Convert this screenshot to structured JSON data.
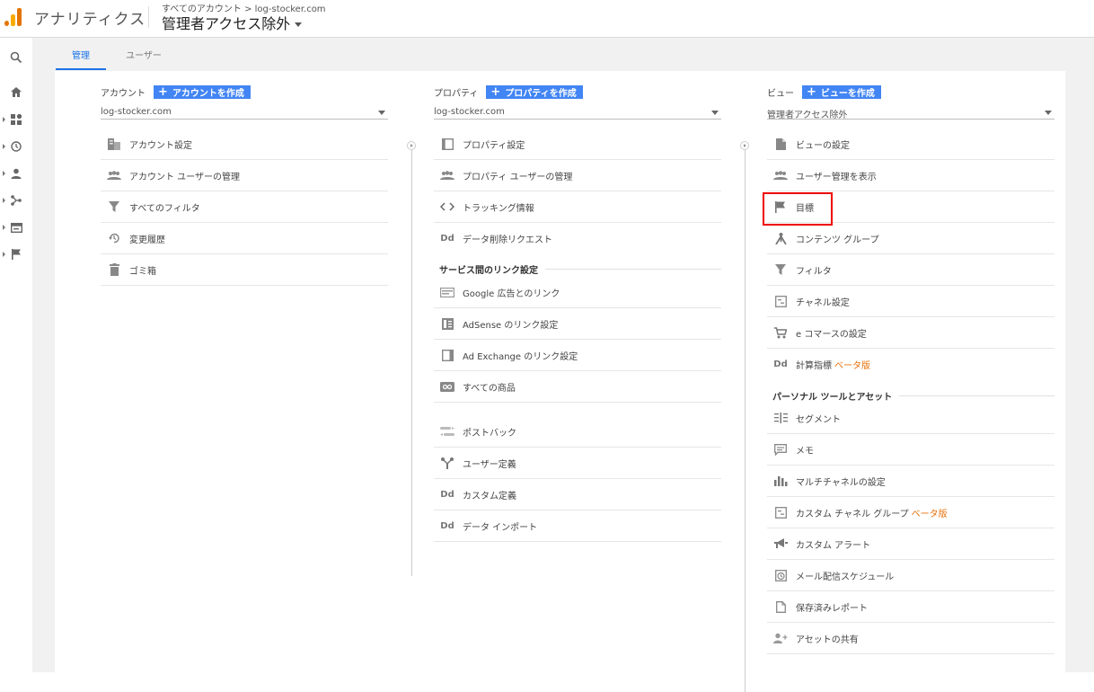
{
  "header": {
    "app_title": "アナリティクス",
    "breadcrumb": "すべてのアカウント > log-stocker.com",
    "view_name": "管理者アクセス除外"
  },
  "tabs": [
    {
      "label": "管理",
      "active": true
    },
    {
      "label": "ユーザー",
      "active": false
    }
  ],
  "account": {
    "heading": "アカウント",
    "create_label": "アカウントを作成",
    "selected": "log-stocker.com",
    "items": [
      {
        "label": "アカウント設定",
        "icon": "building-icon"
      },
      {
        "label": "アカウント ユーザーの管理",
        "icon": "users-icon"
      },
      {
        "label": "すべてのフィルタ",
        "icon": "filter-icon"
      },
      {
        "label": "変更履歴",
        "icon": "history-icon"
      },
      {
        "label": "ゴミ箱",
        "icon": "trash-icon"
      }
    ]
  },
  "property": {
    "heading": "プロパティ",
    "create_label": "プロパティを作成",
    "selected": "log-stocker.com",
    "items": [
      {
        "label": "プロパティ設定",
        "icon": "property-icon"
      },
      {
        "label": "プロパティ ユーザーの管理",
        "icon": "users-icon"
      },
      {
        "label": "トラッキング情報",
        "icon": "code-icon"
      },
      {
        "label": "データ削除リクエスト",
        "icon": "dd-icon"
      }
    ],
    "section_title": "サービス間のリンク設定",
    "link_items": [
      {
        "label": "Google 広告とのリンク",
        "icon": "google-ads-icon"
      },
      {
        "label": "AdSense のリンク設定",
        "icon": "adsense-icon"
      },
      {
        "label": "Ad Exchange のリンク設定",
        "icon": "ad-exchange-icon"
      },
      {
        "label": "すべての商品",
        "icon": "products-icon"
      }
    ],
    "other_items": [
      {
        "label": "ポストバック",
        "icon": "postback-icon"
      },
      {
        "label": "ユーザー定義",
        "icon": "user-defined-icon"
      },
      {
        "label": "カスタム定義",
        "icon": "dd-icon"
      },
      {
        "label": "データ インポート",
        "icon": "dd-icon"
      }
    ]
  },
  "view": {
    "heading": "ビュー",
    "create_label": "ビューを作成",
    "selected": "管理者アクセス除外",
    "items": [
      {
        "label": "ビューの設定",
        "icon": "document-icon"
      },
      {
        "label": "ユーザー管理を表示",
        "icon": "users-icon"
      },
      {
        "label": "目標",
        "icon": "flag-icon"
      },
      {
        "label": "コンテンツ グループ",
        "icon": "content-group-icon"
      },
      {
        "label": "フィルタ",
        "icon": "filter-icon"
      },
      {
        "label": "チャネル設定",
        "icon": "channel-icon"
      },
      {
        "label": "e コマースの設定",
        "icon": "cart-icon"
      },
      {
        "label": "計算指標",
        "beta": "ベータ版",
        "icon": "dd-icon"
      }
    ],
    "section_title": "パーソナル ツールとアセット",
    "personal_items": [
      {
        "label": "セグメント",
        "icon": "segment-icon"
      },
      {
        "label": "メモ",
        "icon": "memo-icon"
      },
      {
        "label": "マルチチャネルの設定",
        "icon": "bar-chart-icon"
      },
      {
        "label": "カスタム チャネル グループ",
        "beta": "ベータ版",
        "icon": "channel-icon"
      },
      {
        "label": "カスタム アラート",
        "icon": "megaphone-icon"
      },
      {
        "label": "メール配信スケジュール",
        "icon": "clock-icon"
      },
      {
        "label": "保存済みレポート",
        "icon": "document-icon"
      },
      {
        "label": "アセットの共有",
        "icon": "person-add-icon"
      }
    ]
  },
  "colors": {
    "accent": "#4285f4",
    "highlight": "#e00000",
    "beta": "#e8710a"
  }
}
